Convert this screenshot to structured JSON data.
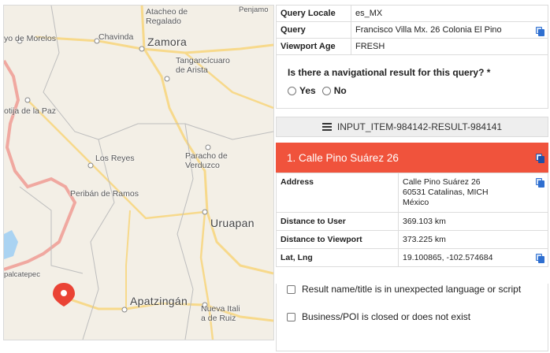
{
  "map": {
    "labels": {
      "atacheo": "Atacheo de Regalado",
      "penjamo": "Penjamo",
      "morelos": "yo de Morelos",
      "chavinda": "Chavinda",
      "zamora": "Zamora",
      "tangancicuaro": "Tangancícuaro de Arista",
      "jiquilpan": "otija de la Paz",
      "los_reyes": "Los Reyes",
      "paracho": "Paracho de Verduzco",
      "periban": "Peribán de Ramos",
      "uruapan": "Uruapan",
      "apatzingan": "Apatzingán",
      "palcatepec": "palcatepec",
      "nueva_italia": "Nueva Italia de Ruiz"
    },
    "pin_icon": "map-pin-icon",
    "colors": {
      "background": "#f3efe6",
      "road": "#f7d98b",
      "highway": "#f0a8a0",
      "pin": "#ea4335"
    }
  },
  "query_info": {
    "rows": [
      {
        "key": "Query Locale",
        "value": "es_MX",
        "copy": false
      },
      {
        "key": "Query",
        "value": "Francisco Villa Mx. 26 Colonia El Pino",
        "copy": true
      },
      {
        "key": "Viewport Age",
        "value": "FRESH",
        "copy": false
      }
    ]
  },
  "navigational": {
    "question": "Is there a navigational result for this query? *",
    "options": [
      "Yes",
      "No"
    ]
  },
  "result_id": "INPUT_ITEM-984142-RESULT-984141",
  "result": {
    "title": "1. Calle Pino Suárez 26",
    "header_color": "#f0533c",
    "address_label": "Address",
    "address_lines": [
      "Calle Pino Suárez 26",
      "60531 Catalinas, MICH",
      "México"
    ],
    "distance_user_label": "Distance to User",
    "distance_user": "369.103 km",
    "distance_viewport_label": "Distance to Viewport",
    "distance_viewport": "373.225 km",
    "latlng_label": "Lat, Lng",
    "latlng": "19.100865, -102.574684"
  },
  "checks": [
    "Result name/title is in unexpected language or script",
    "Business/POI is closed or does not exist"
  ]
}
